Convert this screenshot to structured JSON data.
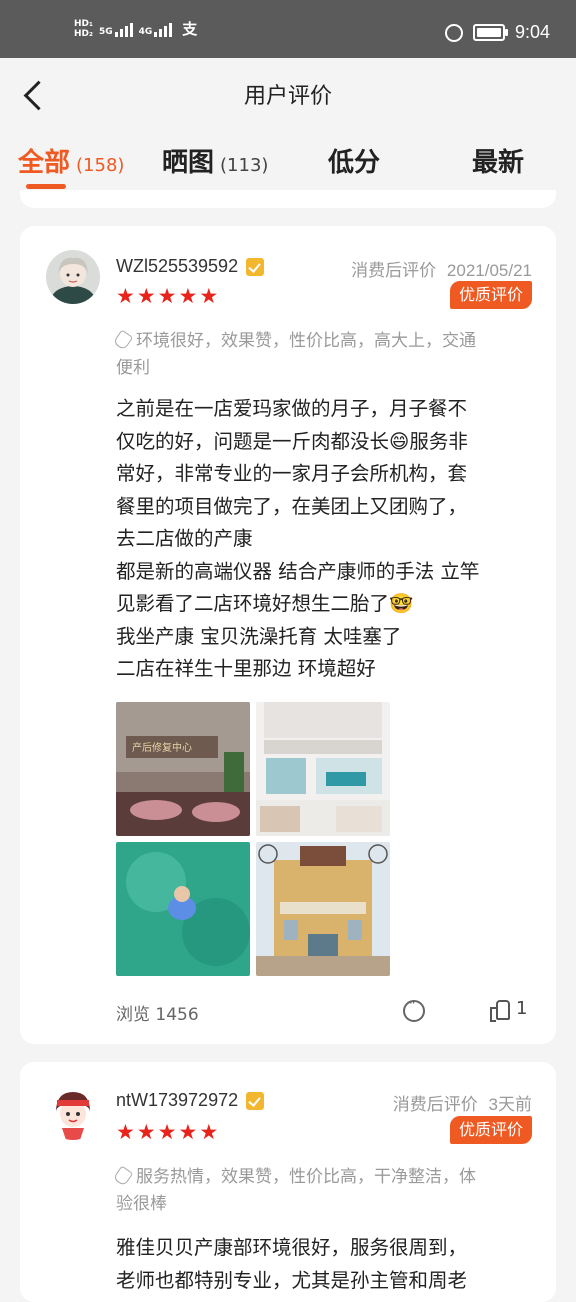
{
  "status_bar": {
    "left_icons": [
      "hd-icon",
      "signal-5g-icon",
      "signal-4g-icon",
      "alipay-icon"
    ],
    "sig1": "5G",
    "sig2": "4G",
    "pay": "支",
    "time": "9:04"
  },
  "header": {
    "title": "用户评价"
  },
  "tabs": [
    {
      "label": "全部",
      "count": "(158)",
      "active": true
    },
    {
      "label": "晒图",
      "count": "(113)",
      "active": false
    },
    {
      "label": "低分",
      "count": "",
      "active": false
    },
    {
      "label": "最新",
      "count": "",
      "active": false
    }
  ],
  "reviews": [
    {
      "username": "WZl525539592",
      "meta": "消费后评价",
      "date": "2021/05/21",
      "badge": "优质评价",
      "stars": 5,
      "tags_lines": [
        "环境很好，效果赞，性价比高，高大上，交通",
        "便利"
      ],
      "content_lines": [
        "之前是在一店爱玛家做的月子，月子餐不",
        "仅吃的好，问题是一斤肉都没长😄服务非",
        "常好，非常专业的一家月子会所机构，套",
        "餐里的项目做完了，在美团上又团购了，",
        "去二店做的产康",
        "都是新的高端仪器 结合产康师的手法 立竿",
        "见影看了二店环境好想生二胎了🤓",
        "我坐产康 宝贝洗澡托育 太哇塞了",
        "二店在祥生十里那边 环境超好"
      ],
      "photo_sign": "产后修复中心",
      "views": "浏览 1456",
      "likes": "1"
    },
    {
      "username": "ntW173972972",
      "meta": "消费后评价",
      "date": "3天前",
      "badge": "优质评价",
      "stars": 5,
      "tags_lines": [
        "服务热情，效果赞，性价比高，干净整洁，体",
        "验很棒"
      ],
      "content_lines": [
        "雅佳贝贝产康部环境很好，服务很周到，",
        "老师也都特别专业，尤其是孙主管和周老"
      ]
    }
  ],
  "colors": {
    "accent": "#ef5a23",
    "star": "#e8231c",
    "badge_yellow": "#f3b72f"
  }
}
